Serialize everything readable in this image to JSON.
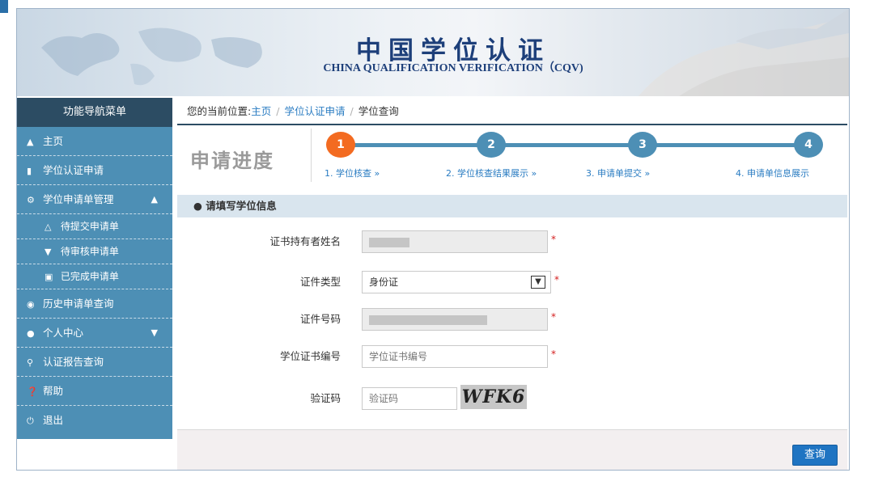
{
  "header": {
    "title": "中国学位认证",
    "subtitle": "CHINA QUALIFICATION VERIFICATION（CQV)"
  },
  "sidebar": {
    "title": "功能导航菜单",
    "items": [
      {
        "label": "主页",
        "icon": "home-icon"
      },
      {
        "label": "学位认证申请",
        "icon": "document-icon"
      },
      {
        "label": "学位申请单管理",
        "icon": "gear-icon"
      },
      {
        "label": "待提交申请单",
        "icon": "warning-icon"
      },
      {
        "label": "待审核申请单",
        "icon": "cart-icon"
      },
      {
        "label": "已完成申请单",
        "icon": "briefcase-icon"
      },
      {
        "label": "历史申请单查询",
        "icon": "camera-icon"
      },
      {
        "label": "个人中心",
        "icon": "user-icon"
      },
      {
        "label": "认证报告查询",
        "icon": "search-icon"
      },
      {
        "label": "帮助",
        "icon": "help-icon"
      },
      {
        "label": "退出",
        "icon": "power-icon"
      }
    ]
  },
  "breadcrumb": {
    "prefix": "您的当前位置:",
    "home": "主页",
    "sep": "/",
    "apply": "学位认证申请",
    "current": "学位查询"
  },
  "progress": {
    "title": "申请进度",
    "steps": [
      {
        "num": "1",
        "label": "1. 学位核查 »"
      },
      {
        "num": "2",
        "label": "2. 学位核查结果展示 »"
      },
      {
        "num": "3",
        "label": "3. 申请单提交 »"
      },
      {
        "num": "4",
        "label": "4. 申请单信息展示"
      }
    ]
  },
  "form": {
    "section_title": "请填写学位信息",
    "holder_label": "证书持有者姓名",
    "id_type_label": "证件类型",
    "id_type_value": "身份证",
    "id_number_label": "证件号码",
    "cert_label": "学位证书编号",
    "cert_placeholder": "学位证书编号",
    "captcha_label": "验证码",
    "captcha_placeholder": "验证码",
    "captcha_text": "WFK6",
    "required_mark": "*"
  },
  "actions": {
    "query_label": "查询"
  },
  "colors": {
    "sidebar": "#4d8fb5",
    "sidebar_head": "#2c4c63",
    "active_step": "#f36b21",
    "primary_button": "#1f74c2"
  }
}
